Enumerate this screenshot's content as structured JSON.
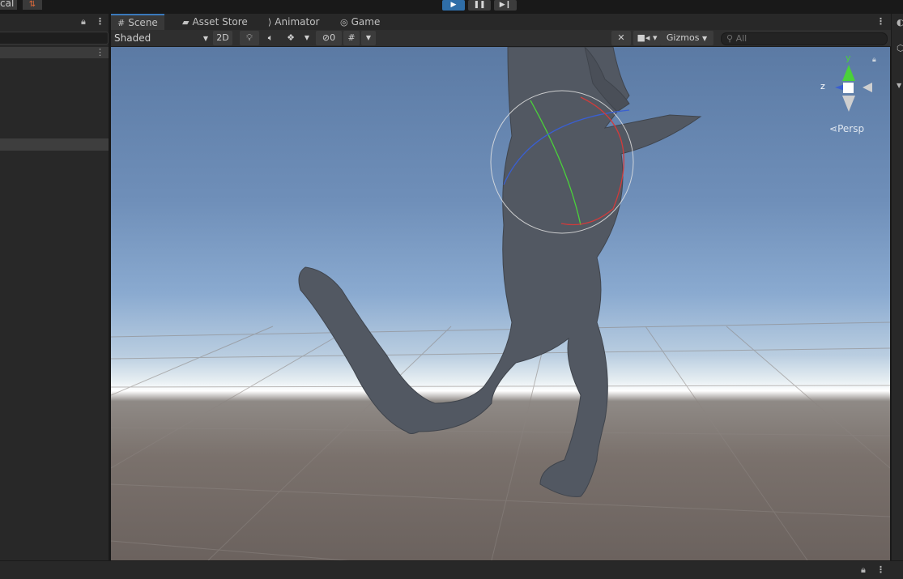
{
  "top": {
    "left_label": "cal",
    "collab_icon": "cloud-sync-icon",
    "play_icon": "play-icon",
    "pause_icon": "pause-icon",
    "step_icon": "step-icon"
  },
  "scene_tabs": [
    {
      "label": "Scene",
      "icon": "grid-icon"
    },
    {
      "label": "Asset Store",
      "icon": "store-icon"
    },
    {
      "label": "Animator",
      "icon": "animator-icon"
    },
    {
      "label": "Game",
      "icon": "gamepad-icon"
    }
  ],
  "scene_toolbar": {
    "draw_mode": "Shaded",
    "mode_2d": "2D",
    "hidden_count": "0",
    "gizmos": "Gizmos",
    "search_placeholder": "All"
  },
  "viewport": {
    "projection_label": "Persp",
    "axis_y": "y",
    "axis_z": "z"
  },
  "colors": {
    "accent": "#3a79bb",
    "play_active": "#2f6ea8",
    "gizmo_x": "#d13b3b",
    "gizmo_y": "#4ad13a",
    "gizmo_z": "#3a5fd1"
  }
}
